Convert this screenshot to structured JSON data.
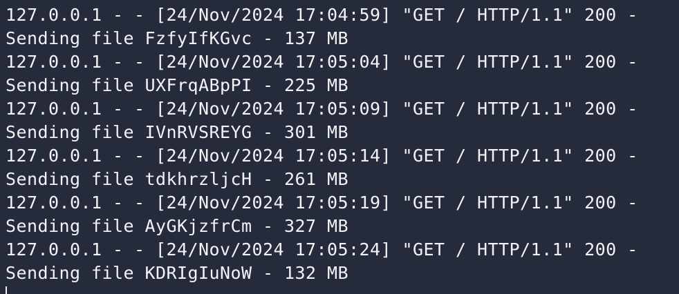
{
  "terminal": {
    "lines": [
      "127.0.0.1 - - [24/Nov/2024 17:04:59] \"GET / HTTP/1.1\" 200 -",
      "Sending file FzfyIfKGvc - 137 MB",
      "127.0.0.1 - - [24/Nov/2024 17:05:04] \"GET / HTTP/1.1\" 200 -",
      "Sending file UXFrqABpPI - 225 MB",
      "127.0.0.1 - - [24/Nov/2024 17:05:09] \"GET / HTTP/1.1\" 200 -",
      "Sending file IVnRVSREYG - 301 MB",
      "127.0.0.1 - - [24/Nov/2024 17:05:14] \"GET / HTTP/1.1\" 200 -",
      "Sending file tdkhrzljcH - 261 MB",
      "127.0.0.1 - - [24/Nov/2024 17:05:19] \"GET / HTTP/1.1\" 200 -",
      "Sending file AyGKjzfrCm - 327 MB",
      "127.0.0.1 - - [24/Nov/2024 17:05:24] \"GET / HTTP/1.1\" 200 -",
      "Sending file KDRIgIuNoW - 132 MB"
    ]
  },
  "colors": {
    "background": "#252b3a",
    "text": "#f2f3f6"
  }
}
